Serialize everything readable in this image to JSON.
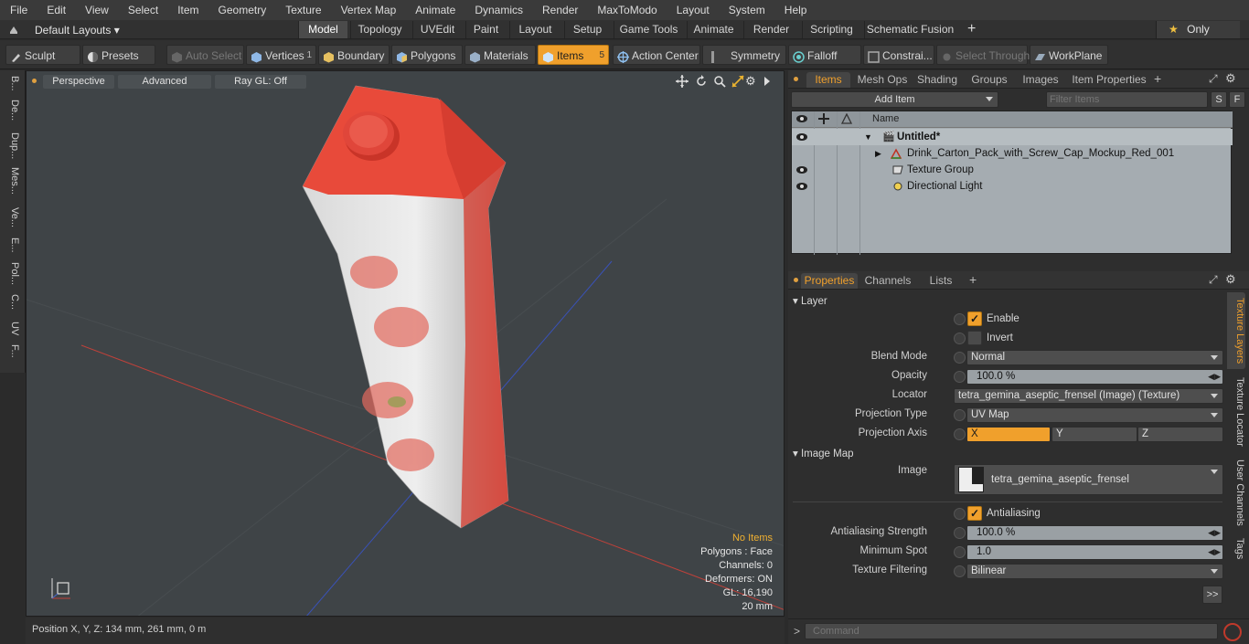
{
  "menu": [
    "File",
    "Edit",
    "View",
    "Select",
    "Item",
    "Geometry",
    "Texture",
    "Vertex Map",
    "Animate",
    "Dynamics",
    "Render",
    "MaxToModo",
    "Layout",
    "System",
    "Help"
  ],
  "layout_bar": {
    "layouts_dropdown": "Default Layouts",
    "tabs": [
      "Model",
      "Topology",
      "UVEdit",
      "Paint",
      "Layout",
      "Setup",
      "Game Tools",
      "Animate",
      "Render",
      "Scripting",
      "Schematic Fusion"
    ],
    "active_tab": "Model",
    "add": "+",
    "only": "Only"
  },
  "toolbar": {
    "sculpt": "Sculpt",
    "presets": "Presets",
    "auto_select": "Auto Select",
    "vertices": "Vertices",
    "vertices_count": "1",
    "boundary": "Boundary",
    "polygons": "Polygons",
    "materials": "Materials",
    "items": "Items",
    "items_count": "5",
    "action_center": "Action Center",
    "symmetry": "Symmetry",
    "falloff": "Falloff",
    "constraints": "Constrai...",
    "select_through": "Select Through",
    "workplane": "WorkPlane"
  },
  "left_tabs": [
    "B...",
    "De...",
    "Dup...",
    "Mes...",
    "Ve...",
    "E...",
    "Pol...",
    "C...",
    "UV",
    "F..."
  ],
  "viewport": {
    "perspective": "Perspective",
    "advanced": "Advanced",
    "raygl": "Ray GL: Off",
    "stats": {
      "no_items": "No Items",
      "polygons": "Polygons : Face",
      "channels": "Channels: 0",
      "deformers": "Deformers: ON",
      "gl": "GL: 16,190",
      "scale": "20 mm"
    }
  },
  "status": {
    "position": "Position X, Y, Z:   134 mm, 261 mm, 0 m"
  },
  "items_panel": {
    "tabs": [
      "Items",
      "Mesh Ops",
      "Shading",
      "Groups",
      "Images",
      "Item Properties"
    ],
    "active_tab": "Items",
    "add_item": "Add Item",
    "filter": "Filter Items",
    "s": "S",
    "f": "F",
    "name_header": "Name",
    "rows": [
      {
        "label": "Untitled*",
        "bold": true
      },
      {
        "label": "Drink_Carton_Pack_with_Screw_Cap_Mockup_Red_001"
      },
      {
        "label": "Texture Group"
      },
      {
        "label": "Directional Light"
      }
    ]
  },
  "properties_panel": {
    "tabs": [
      "Properties",
      "Channels",
      "Lists"
    ],
    "active_tab": "Properties",
    "add": "+",
    "layer_section": "Layer",
    "enable": "Enable",
    "invert": "Invert",
    "blend_mode": {
      "label": "Blend Mode",
      "value": "Normal"
    },
    "opacity": {
      "label": "Opacity",
      "value": "100.0 %"
    },
    "locator": {
      "label": "Locator",
      "value": "tetra_gemina_aseptic_frensel (Image) (Texture)"
    },
    "projection_type": {
      "label": "Projection Type",
      "value": "UV Map"
    },
    "projection_axis": {
      "label": "Projection Axis",
      "x": "X",
      "y": "Y",
      "z": "Z"
    },
    "image_map_section": "Image Map",
    "image": {
      "label": "Image",
      "value": "tetra_gemina_aseptic_frensel"
    },
    "antialiasing": "Antialiasing",
    "antialiasing_strength": {
      "label": "Antialiasing Strength",
      "value": "100.0 %"
    },
    "minimum_spot": {
      "label": "Minimum Spot",
      "value": "1.0"
    },
    "texture_filtering": {
      "label": "Texture Filtering",
      "value": "Bilinear"
    },
    "more": ">>",
    "side_tabs": [
      "Texture Layers",
      "Texture Locator",
      "User Channels",
      "Tags"
    ]
  },
  "command": {
    "placeholder": "Command",
    "prompt": ">"
  },
  "colors": {
    "accent": "#f0a02c",
    "carton_red": "#e84a3a",
    "list_bg": "#a5acb1"
  }
}
